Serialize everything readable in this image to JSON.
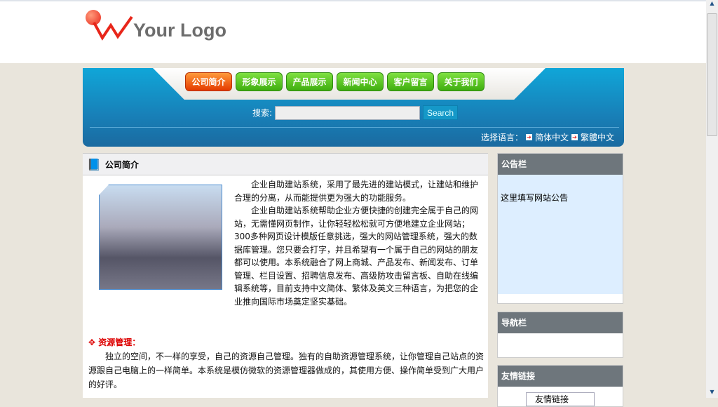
{
  "logo": {
    "text": "Your Logo"
  },
  "nav": {
    "items": [
      "公司简介",
      "形象展示",
      "产品展示",
      "新闻中心",
      "客户留言",
      "关于我们"
    ],
    "active": 0
  },
  "search": {
    "label": "搜索:",
    "value": "",
    "button": "Search"
  },
  "language": {
    "label": "选择语言：",
    "options": [
      "简体中文",
      "繁體中文"
    ]
  },
  "main": {
    "title": "公司简介",
    "intro": [
      "企业自助建站系统，采用了最先进的建站模式，让建站和维护合理的分离，从而能提供更为强大的功能服务。",
      "企业自助建站系统帮助企业方便快捷的创建完全属于自己的网站，无需懂网页制作，让你轻轻松松就可方便地建立企业网站；300多种网页设计模版任意挑选，强大的网站管理系统，强大的数据库管理。您只要会打字，并且希望有一个属于自己的网站的朋友都可以使用。本系统融合了网上商城、产品发布、新闻发布、订单管理、栏目设置、招聘信息发布、高级防攻击留言板、自助在线编辑系统等，目前支持中文简体、繁体及英文三种语言，为把您的企业推向国际市场奠定坚实基础。"
    ],
    "resource_title": "资源管理：",
    "resource_text": "独立的空间，不一样的享受，自己的资源自己管理。独有的自助资源管理系统，让你管理自己站点的资源跟自己电脑上的一样简单。本系统是模仿微软的资源管理器做成的，其使用方便、操作简单受到广大用户的好评。"
  },
  "sidebar": {
    "notice_title": "公告栏",
    "notice_text": "这里填写网站公告",
    "nav_title": "导航栏",
    "links_title": "友情链接",
    "links_select": "友情链接"
  },
  "colors": {
    "banner": "#1394c8",
    "nav_green": "#4cc21a",
    "nav_active": "#f05a10",
    "side_header": "#6e767c",
    "bg": "#e9e5dc"
  }
}
